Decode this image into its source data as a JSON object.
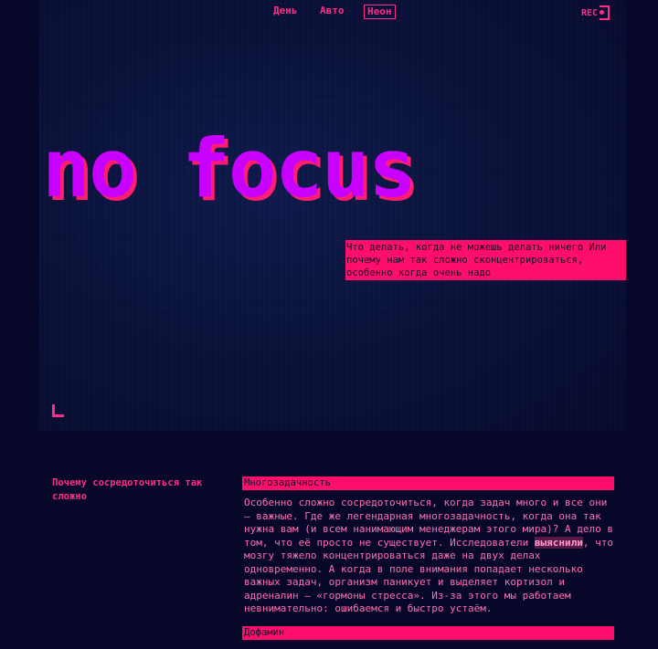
{
  "nav": {
    "items": [
      {
        "label": "День",
        "active": false
      },
      {
        "label": "Авто",
        "active": false
      },
      {
        "label": "Неон",
        "active": true
      }
    ],
    "rec_label": "REC"
  },
  "hero": {
    "title": "no focus",
    "subtitle": "Что делать, когда не можешь делать ничего Или почему нам так сложно сконцентрироваться, особенно когда очень надо"
  },
  "article": {
    "side_title": "Почему сосредоточиться так сложно",
    "sections": [
      {
        "heading": "Многозадачность",
        "text_before": "Особенно сложно сосредоточиться, когда задач много и все они — важные. Где же легендарная многозадачность, когда она так нужна вам (и всем нанимающим менеджерам этого мира)? А дело в том, что её просто не существует. Исследователи ",
        "link": "выяснили",
        "text_after": ", что мозгу тяжело концентрироваться даже на двух делах одновременно. А когда в поле внимания попадает несколько важных задач, организм паникует и выделяет кортизол и адреналин — «гормоны стресса». Из-за этого мы работаем невнимательно: ошибаемся и быстро устаём."
      },
      {
        "heading": "Дофамин"
      }
    ]
  },
  "colors": {
    "background": "#07072a",
    "accent": "#ff0f6b",
    "title": "#c800ff"
  }
}
